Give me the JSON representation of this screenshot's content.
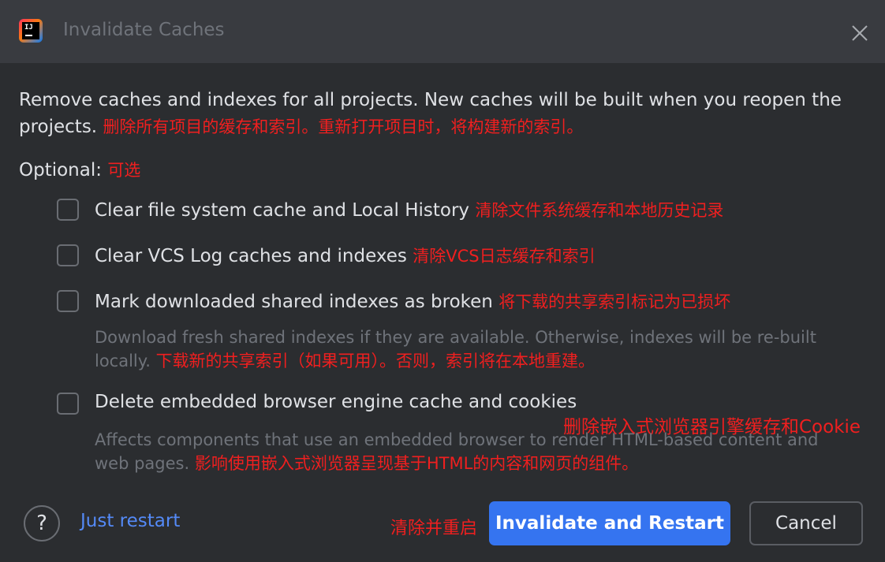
{
  "dialog": {
    "title": "Invalidate Caches",
    "description": "Remove caches and indexes for all projects. New caches will be built when you reopen the projects.",
    "description_note": "删除所有项目的缓存和索引。重新打开项目时，将构建新的索引。",
    "optional_label": "Optional:",
    "optional_note": "可选"
  },
  "options": [
    {
      "label": "Clear file system cache and Local History",
      "note": "清除文件系统缓存和本地历史记录",
      "checked": false
    },
    {
      "label": "Clear VCS Log caches and indexes",
      "note": "清除VCS日志缓存和索引",
      "checked": false
    },
    {
      "label": "Mark downloaded shared indexes as broken",
      "note": "将下载的共享索引标记为已损坏",
      "checked": false,
      "hint": "Download fresh shared indexes if they are available. Otherwise, indexes will be re-built locally.",
      "hint_note": "下载新的共享索引（如果可用）。否则，索引将在本地重建。"
    },
    {
      "label": "Delete embedded browser engine cache and cookies",
      "note": "删除嵌入式浏览器引擎缓存和Cookie",
      "checked": false,
      "hint": "Affects components that use an embedded browser to render HTML-based content and web pages.",
      "hint_note": "影响使用嵌入式浏览器呈现基于HTML的内容和网页的组件。"
    }
  ],
  "footer": {
    "help_icon": "?",
    "just_restart": "Just restart",
    "primary_note": "清除并重启",
    "primary_label": "Invalidate and Restart",
    "cancel_label": "Cancel"
  },
  "colors": {
    "background": "#2b2d30",
    "titlebar": "#393b40",
    "accent": "#3574f0",
    "link": "#548af7",
    "annotation": "#f01f1f"
  }
}
